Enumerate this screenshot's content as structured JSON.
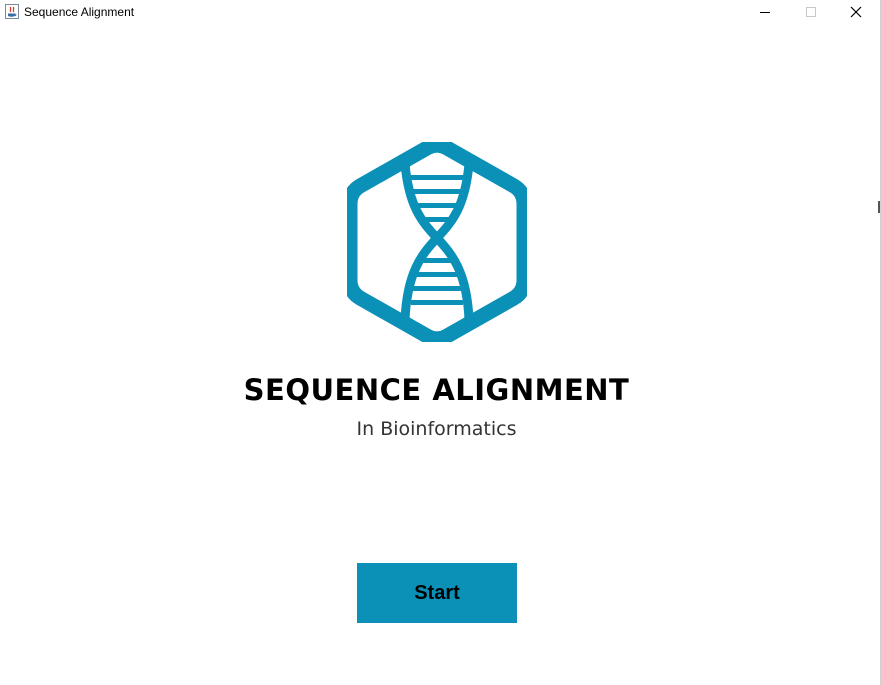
{
  "window": {
    "title": "Sequence Alignment",
    "controls": {
      "minimize": "minimize-icon",
      "maximize": "maximize-icon",
      "close": "close-icon"
    }
  },
  "app_icon": "java-icon",
  "logo": {
    "icon": "dna-hexagon-icon",
    "color": "#0b90b8"
  },
  "heading": {
    "title": "SEQUENCE ALIGNMENT",
    "subtitle": "In Bioinformatics"
  },
  "start_button": {
    "label": "Start",
    "color": "#0b90b8"
  }
}
